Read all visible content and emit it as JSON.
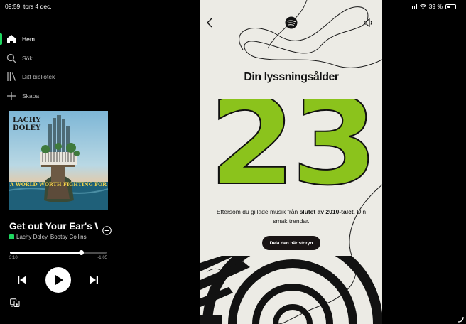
{
  "status_bar": {
    "time": "09:59",
    "date": "tors 4 dec.",
    "battery": "39 %"
  },
  "sidebar": {
    "items": [
      {
        "label": "Hem",
        "icon": "home-icon",
        "active": true
      },
      {
        "label": "Sök",
        "icon": "search-icon",
        "active": false
      },
      {
        "label": "Ditt bibliotek",
        "icon": "library-icon",
        "active": false
      },
      {
        "label": "Skapa",
        "icon": "plus-icon",
        "active": false
      }
    ]
  },
  "now_playing": {
    "cover": {
      "artist_text": "LACHY\nDOLEY",
      "album_text": "A WORLD WORTH FIGHTING FOR"
    },
    "title": "Get out Your Ear's Way",
    "artists": "Lachy Doley, Bootsy Collins",
    "elapsed": "3:10",
    "remaining": "-1:05",
    "progress": 0.74
  },
  "story": {
    "heading": "Din lyssningsålder",
    "age": "23",
    "description_pre": "Eftersom du gillade musik från ",
    "description_bold": "slutet av 2010-talet",
    "description_post": ". Din smak trendar.",
    "share_label": "Dela den här storyn"
  },
  "colors": {
    "accent_green": "#1ed760",
    "number_green": "#8bc31c",
    "story_bg": "#ecebe5"
  }
}
